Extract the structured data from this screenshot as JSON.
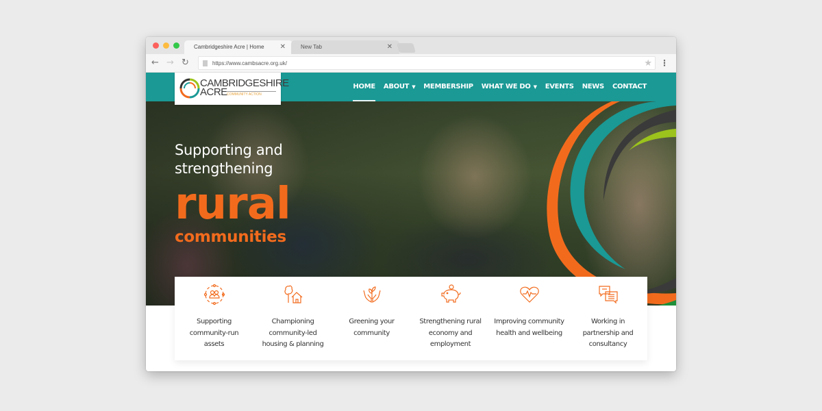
{
  "browser": {
    "tabs": [
      {
        "title": "Cambridgeshire Acre | Home",
        "active": true
      },
      {
        "title": "New Tab",
        "active": false
      }
    ],
    "url": "https://www.cambsacre.org.uk/",
    "close_glyph": "✕",
    "back_glyph": "←",
    "forward_glyph": "→",
    "reload_glyph": "↻",
    "star_glyph": "★",
    "menu_glyph": "⋮"
  },
  "site": {
    "logo": {
      "line1": "CAMBRIDGESHIRE",
      "line2": "ACRE",
      "tagline": "COMMUNITY ACTION"
    },
    "nav": [
      {
        "label": "HOME",
        "active": true,
        "has_dropdown": false
      },
      {
        "label": "ABOUT",
        "active": false,
        "has_dropdown": true
      },
      {
        "label": "MEMBERSHIP",
        "active": false,
        "has_dropdown": false
      },
      {
        "label": "WHAT WE DO",
        "active": false,
        "has_dropdown": true
      },
      {
        "label": "EVENTS",
        "active": false,
        "has_dropdown": false
      },
      {
        "label": "NEWS",
        "active": false,
        "has_dropdown": false
      },
      {
        "label": "CONTACT",
        "active": false,
        "has_dropdown": false
      }
    ],
    "caret_glyph": "▼",
    "hero": {
      "line1": "Supporting and",
      "line2": "strengthening",
      "big": "rural",
      "medium": "communities"
    },
    "features": [
      {
        "icon": "community-assets-icon",
        "label": "Supporting community-run assets"
      },
      {
        "icon": "tree-house-icon",
        "label": "Championing community-led housing & planning"
      },
      {
        "icon": "hands-plant-icon",
        "label": "Greening your community"
      },
      {
        "icon": "piggy-bank-icon",
        "label": "Strengthening rural economy and employment"
      },
      {
        "icon": "heart-pulse-icon",
        "label": "Improving community health and wellbeing"
      },
      {
        "icon": "chat-bubbles-icon",
        "label": "Working in partnership and consultancy"
      }
    ]
  },
  "colors": {
    "teal": "#1a9995",
    "orange": "#f26b1d",
    "lime": "#9bc31c",
    "dark": "#333333",
    "logo_tagline": "#e6a23c"
  }
}
